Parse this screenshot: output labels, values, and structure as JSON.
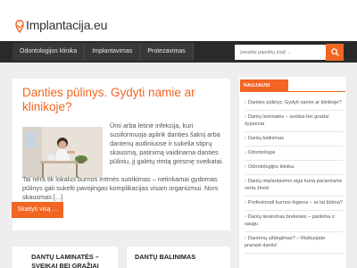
{
  "header": {
    "logo_text": "Implantacija.eu"
  },
  "nav": {
    "items": [
      "Odontologijos klinika",
      "Implantavimas",
      "Protezavimas"
    ],
    "search_placeholder": "Įveskite paieškų žodį ..."
  },
  "article": {
    "title": "Danties pūlinys. Gydyti namie ar klinikoje?",
    "excerpt_side": "Ūmi arba lėtinė infekcija, kuri susiformuoja aplink danties šaknį arba dantenų audiniuose ir sukelia stiprų skausmą, patinimą vaidinama danties pūliniu, jį galėtų rimtą grėsmę sveikatai.",
    "excerpt_full": "Tai nėra tik lokalus burnos ertmės sutrikimas – netinkamai gydomas pūlinys gali sukelti pavojingas komplikacijas visam organizmui. Nors skausmas [...]",
    "read_more": "Skaityti visą ..."
  },
  "cards": [
    {
      "title": "DANTŲ LAMINATĖS – SVEIKAI BEI GRAŽIAI ŠYPSENAI"
    },
    {
      "title": "DANTŲ BALINIMAS"
    }
  ],
  "sidebar": {
    "heading": "NAUJAUSI ĮRAŠAI",
    "items": [
      "Danties pūlinys. Gydyti namie ar klinikoje?",
      "Dantų laminatės – sveikai bei gražiai šypsenai",
      "Dantų balinimas",
      "Odontologai",
      "Odontologijos klinika",
      "Dantų implantavimo eiga kurią pacientams verta žinoti",
      "Profesionali burnos higiena – ar tai būtina?",
      "Dantų tiesinimas breketais – patikima ir saugu",
      "Dantenų uždegimas? – Rizikuojate prarasti dantis!"
    ]
  },
  "colors": {
    "accent": "#f26522",
    "nav_bg": "#2a2a2a",
    "page_bg": "#eeeeee"
  }
}
